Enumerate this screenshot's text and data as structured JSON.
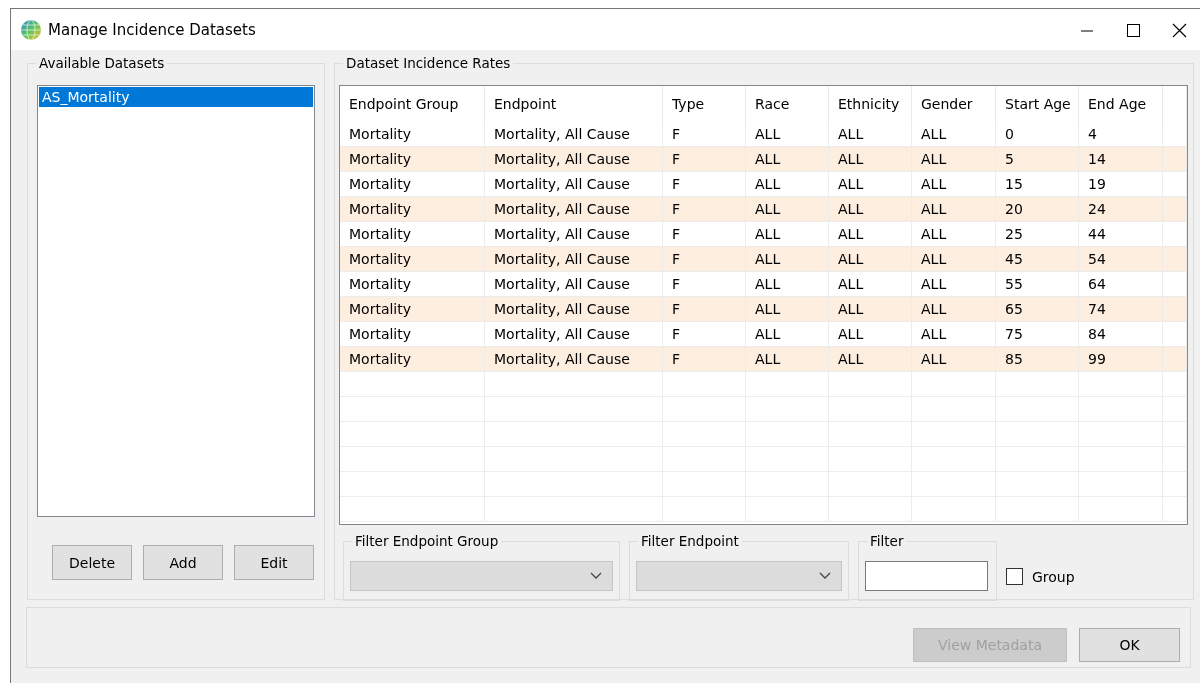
{
  "window": {
    "title": "Manage Incidence Datasets"
  },
  "available_datasets": {
    "label": "Available Datasets",
    "items": [
      {
        "name": "AS_Mortality",
        "selected": true
      }
    ],
    "buttons": [
      {
        "label": "Delete",
        "disabled": false
      },
      {
        "label": "Add",
        "disabled": false
      },
      {
        "label": "Edit",
        "disabled": false
      }
    ]
  },
  "incidence_rates": {
    "label": "Dataset Incidence Rates",
    "columns": [
      "Endpoint Group",
      "Endpoint",
      "Type",
      "Race",
      "Ethnicity",
      "Gender",
      "Start Age",
      "End Age"
    ],
    "rows": [
      [
        "Mortality",
        "Mortality, All Cause",
        "F",
        "ALL",
        "ALL",
        "ALL",
        "0",
        "4"
      ],
      [
        "Mortality",
        "Mortality, All Cause",
        "F",
        "ALL",
        "ALL",
        "ALL",
        "5",
        "14"
      ],
      [
        "Mortality",
        "Mortality, All Cause",
        "F",
        "ALL",
        "ALL",
        "ALL",
        "15",
        "19"
      ],
      [
        "Mortality",
        "Mortality, All Cause",
        "F",
        "ALL",
        "ALL",
        "ALL",
        "20",
        "24"
      ],
      [
        "Mortality",
        "Mortality, All Cause",
        "F",
        "ALL",
        "ALL",
        "ALL",
        "25",
        "44"
      ],
      [
        "Mortality",
        "Mortality, All Cause",
        "F",
        "ALL",
        "ALL",
        "ALL",
        "45",
        "54"
      ],
      [
        "Mortality",
        "Mortality, All Cause",
        "F",
        "ALL",
        "ALL",
        "ALL",
        "55",
        "64"
      ],
      [
        "Mortality",
        "Mortality, All Cause",
        "F",
        "ALL",
        "ALL",
        "ALL",
        "65",
        "74"
      ],
      [
        "Mortality",
        "Mortality, All Cause",
        "F",
        "ALL",
        "ALL",
        "ALL",
        "75",
        "84"
      ],
      [
        "Mortality",
        "Mortality, All Cause",
        "F",
        "ALL",
        "ALL",
        "ALL",
        "85",
        "99"
      ]
    ]
  },
  "filters": [
    {
      "kind": "dropdown",
      "label": "Filter Endpoint Group",
      "disabled": true
    },
    {
      "kind": "dropdown",
      "label": "Filter Endpoint",
      "disabled": true
    },
    {
      "kind": "text",
      "label": "Filter"
    }
  ],
  "group_checkbox": {
    "label": "Group",
    "checked": false
  },
  "footer_buttons": [
    {
      "label": "View Metadata",
      "disabled": true
    },
    {
      "label": "OK",
      "disabled": false
    }
  ]
}
